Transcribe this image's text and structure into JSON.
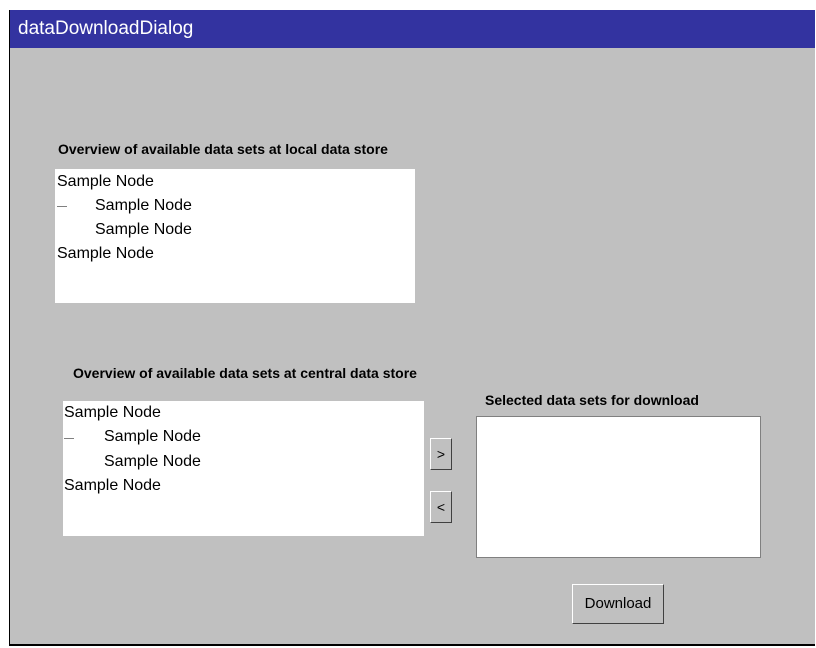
{
  "window": {
    "title": "dataDownloadDialog"
  },
  "local_store": {
    "label": "Overview of available data sets at local data store",
    "nodes": [
      "Sample Node",
      "Sample Node",
      "Sample Node",
      "Sample Node"
    ]
  },
  "central_store": {
    "label": "Overview of available data sets at central data store",
    "nodes": [
      "Sample Node",
      "Sample Node",
      "Sample Node",
      "Sample Node"
    ]
  },
  "selected": {
    "label": "Selected data sets for download"
  },
  "buttons": {
    "add_label": ">",
    "remove_label": "<",
    "download_label": "Download"
  },
  "colors": {
    "titlebar": "#3333a0",
    "dialog_background": "#c0c0c0"
  }
}
